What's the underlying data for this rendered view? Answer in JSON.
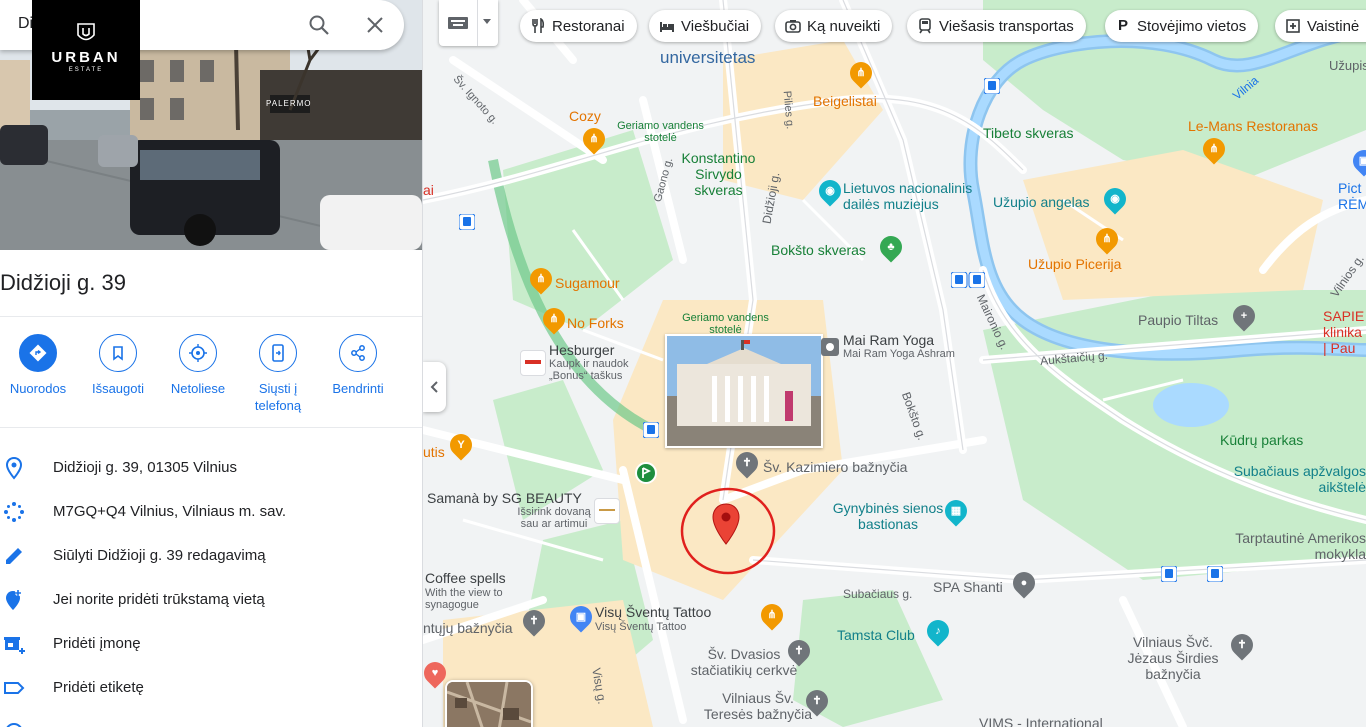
{
  "search": {
    "query": "Di"
  },
  "logo": {
    "line1": "URBAN",
    "line2": "ESTATE"
  },
  "photo": {
    "shop_sign": "PALERMO"
  },
  "place": {
    "title": "Didžioji g. 39"
  },
  "actions": [
    {
      "label": "Nuorodos",
      "icon": "directions-icon"
    },
    {
      "label": "Išsaugoti",
      "icon": "bookmark-icon"
    },
    {
      "label": "Netoliese",
      "icon": "nearby-icon"
    },
    {
      "label": "Siųsti į telefoną",
      "icon": "send-to-phone-icon"
    },
    {
      "label": "Bendrinti",
      "icon": "share-icon"
    }
  ],
  "info": [
    {
      "text": "Didžioji g. 39, 01305 Vilnius",
      "icon": "location-pin-icon"
    },
    {
      "text": "M7GQ+Q4 Vilnius, Vilniaus m. sav.",
      "icon": "plus-code-icon"
    },
    {
      "text": "Siūlyti Didžioji g. 39 redagavimą",
      "icon": "edit-pencil-icon"
    },
    {
      "text": "Jei norite pridėti trūkstamą vietą",
      "icon": "add-place-icon"
    },
    {
      "text": "Pridėti įmonę",
      "icon": "add-business-icon"
    },
    {
      "text": "Pridėti etiketę",
      "icon": "label-icon"
    }
  ],
  "chips": [
    {
      "label": "Restoranai",
      "icon": "fork-knife-icon"
    },
    {
      "label": "Viešbučiai",
      "icon": "bed-icon"
    },
    {
      "label": "Ką nuveikti",
      "icon": "camera-icon"
    },
    {
      "label": "Viešasis transportas",
      "icon": "train-icon"
    },
    {
      "label": "Stovėjimo vietos",
      "icon": "parking-icon"
    },
    {
      "label": "Vaistinė",
      "icon": "pharmacy-icon"
    }
  ],
  "map_labels": {
    "universitetas": "universitetas",
    "beigelistai": "Beigelistai",
    "cozy": "Cozy",
    "water1": "Geriamo vandens stotelė",
    "konstantino": "Konstantino Sirvydo skveras",
    "tibeto": "Tibeto skveras",
    "lemans": "Le-Mans Restoranas",
    "lnm": "Lietuvos nacionalinis dailės muziejus",
    "uzupio_angelas": "Užupio angelas",
    "picture": "Pict RĖM",
    "bokstoskveras": "Bokšto skveras",
    "uzupio_picerija": "Užupio Picerija",
    "sugamour": "Sugamour",
    "noforks": "No Forks",
    "water2": "Geriamo vandens stotelė",
    "hesburger": "Hesburger",
    "hesburger_sub": "Kaupk ir naudok „Bonus“ taškus",
    "maram": "Mai Ram Yoga",
    "maram_sub": "Mai Ram Yoga Ashram",
    "paupio": "Paupio Tiltas",
    "sapiegos": "SAPIE klinika | Pau",
    "kudru": "Kūdrų parkas",
    "kazimiero": "Šv. Kazimiero bažnyčia",
    "samana": "Samanà by SG BEAUTY",
    "samana_sub": "Išsirink dovaną sau ar artimui",
    "gynybines": "Gynybinės sienos bastionas",
    "subacius": "Subačiaus apžvalgos aikštelė",
    "tarptautine": "Tarptautinė Amerikos mokykla",
    "coffee": "Coffee spells",
    "coffee_sub": "With the view to synagogue",
    "tattoo": "Visų Šventų Tattoo",
    "tattoo_sub": "Visų Šventų Tattoo",
    "spa": "SPA Shanti",
    "tamsta": "Tamsta Club",
    "dvasios": "Šv. Dvasios stačiatikių cerkvė",
    "jezaus": "Vilniaus Švč. Jėzaus Širdies bažnyčia",
    "teresės": "Vilniaus Šv. Teresės bažnyčia",
    "visu_baz": "ntųjų bažnyčia",
    "utis": "utis",
    "vims": "VIMS - International",
    "vilnia": "Vilnia",
    "uzupis_small": "Užupis",
    "ai": "ai"
  },
  "streets": [
    "Šv. Ignoto g.",
    "Gaono g.",
    "Pilies g.",
    "Didžioji g.",
    "Bokšto g.",
    "Maironio g.",
    "Aukštaičių g.",
    "Subačiaus g.",
    "Visų g.",
    "Vilnios g."
  ]
}
